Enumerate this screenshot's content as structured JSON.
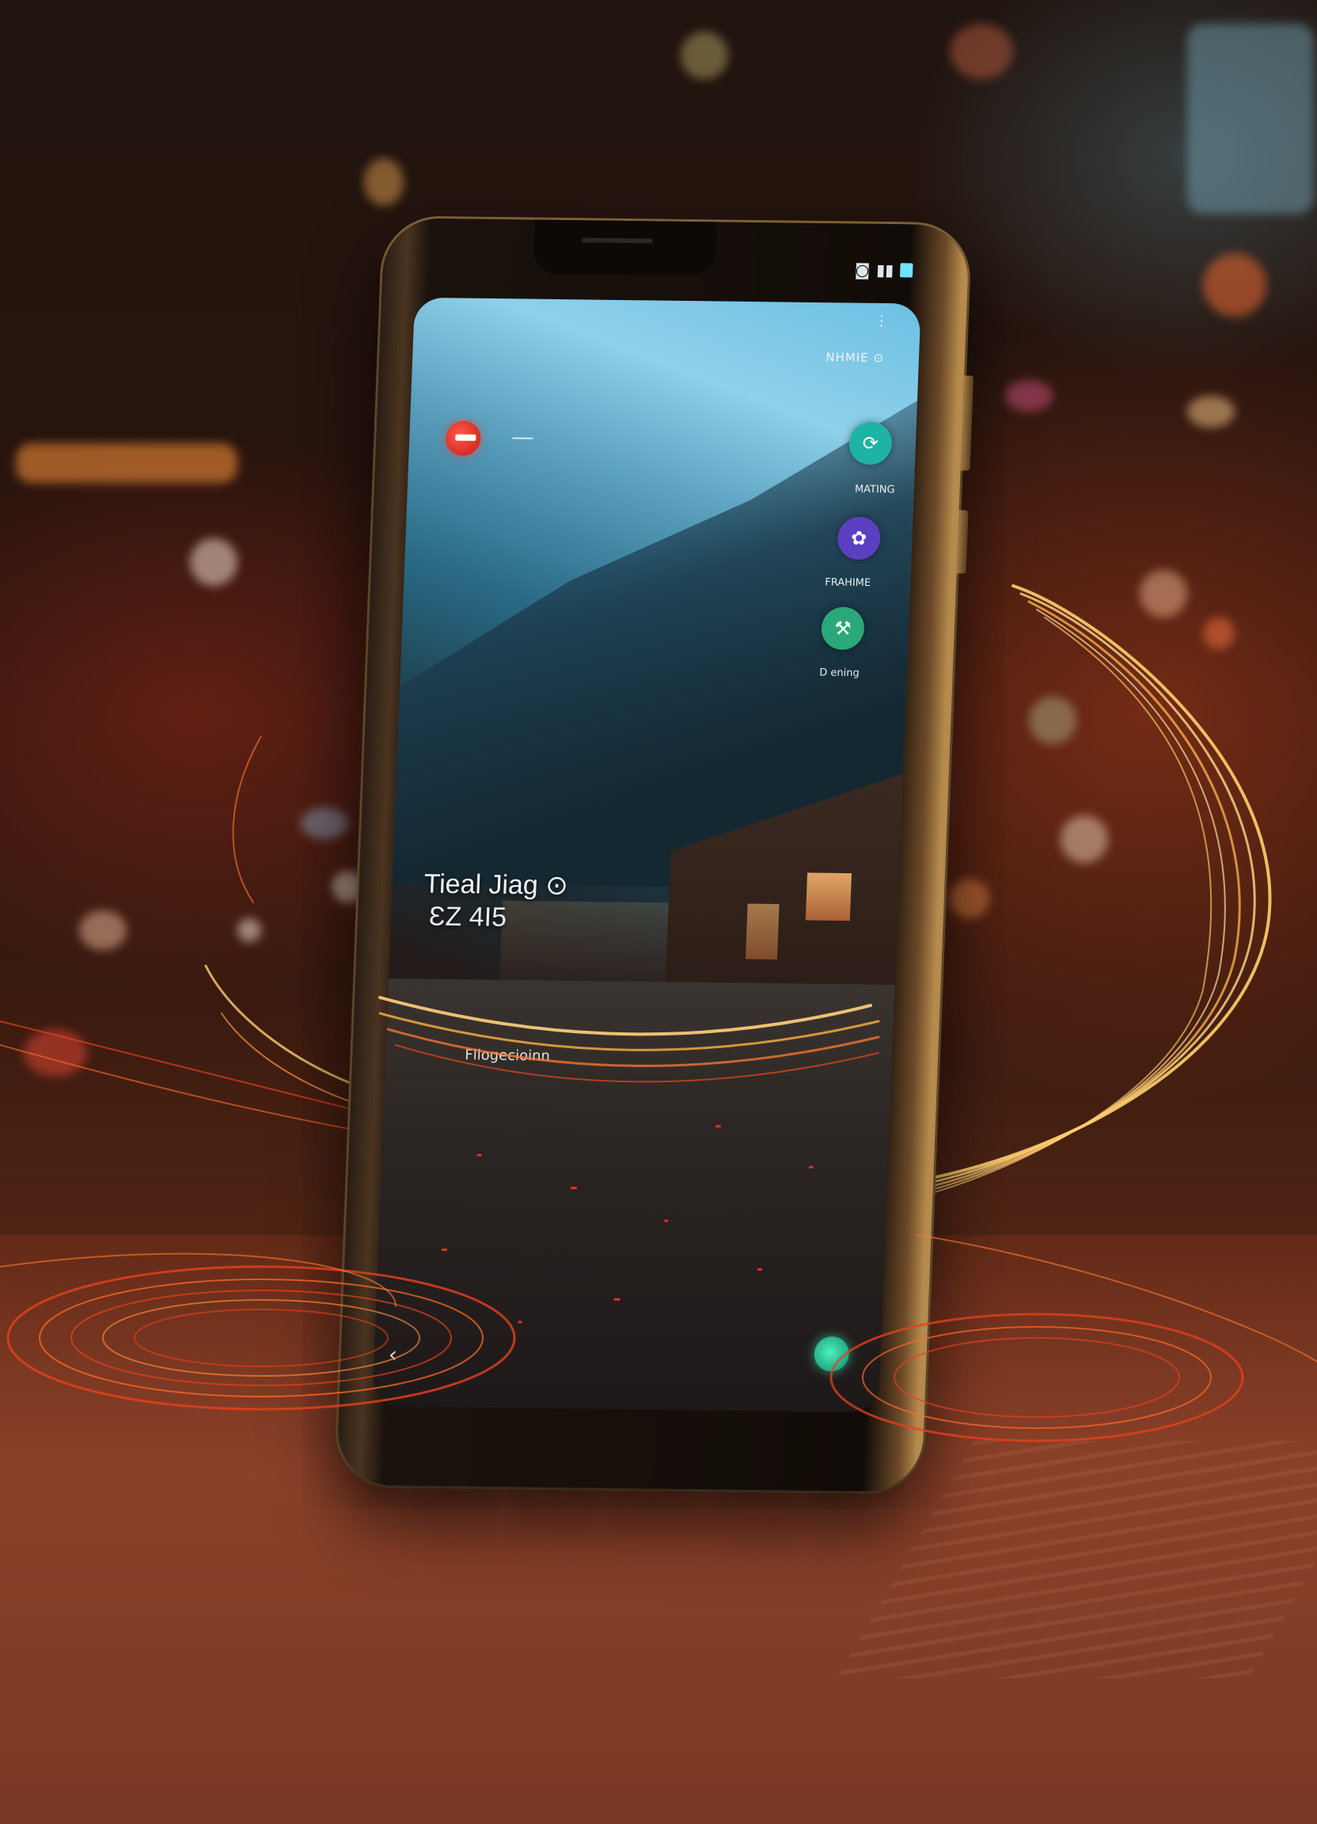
{
  "status_bar": {
    "icons": [
      "camera-icon",
      "signal-icon",
      "battery-icon"
    ],
    "more_icon": "⋮"
  },
  "top_right_label": "NHMIE ⊙",
  "apps": [
    {
      "label": "MATING",
      "icon": "sync-icon",
      "color": "#1fb3a5"
    },
    {
      "label": "FRAHIME",
      "icon": "gamepad-icon",
      "color": "#5a3fc0"
    },
    {
      "label": "D ening",
      "icon": "hammer-icon",
      "color": "#2aa87a"
    }
  ],
  "clock": {
    "title": "Tieal Jiag ⊙",
    "time": "ƐZ 4I5"
  },
  "footer_text": "Fllogecioinn",
  "nav": {
    "back_icon": "‹"
  },
  "colors": {
    "accent_teal": "#1fd6a0",
    "badge_red": "#e0281c",
    "phone_gold": "#b58a4c",
    "swirl_gold": "#ffcf6a",
    "swirl_red": "#e8401e"
  }
}
